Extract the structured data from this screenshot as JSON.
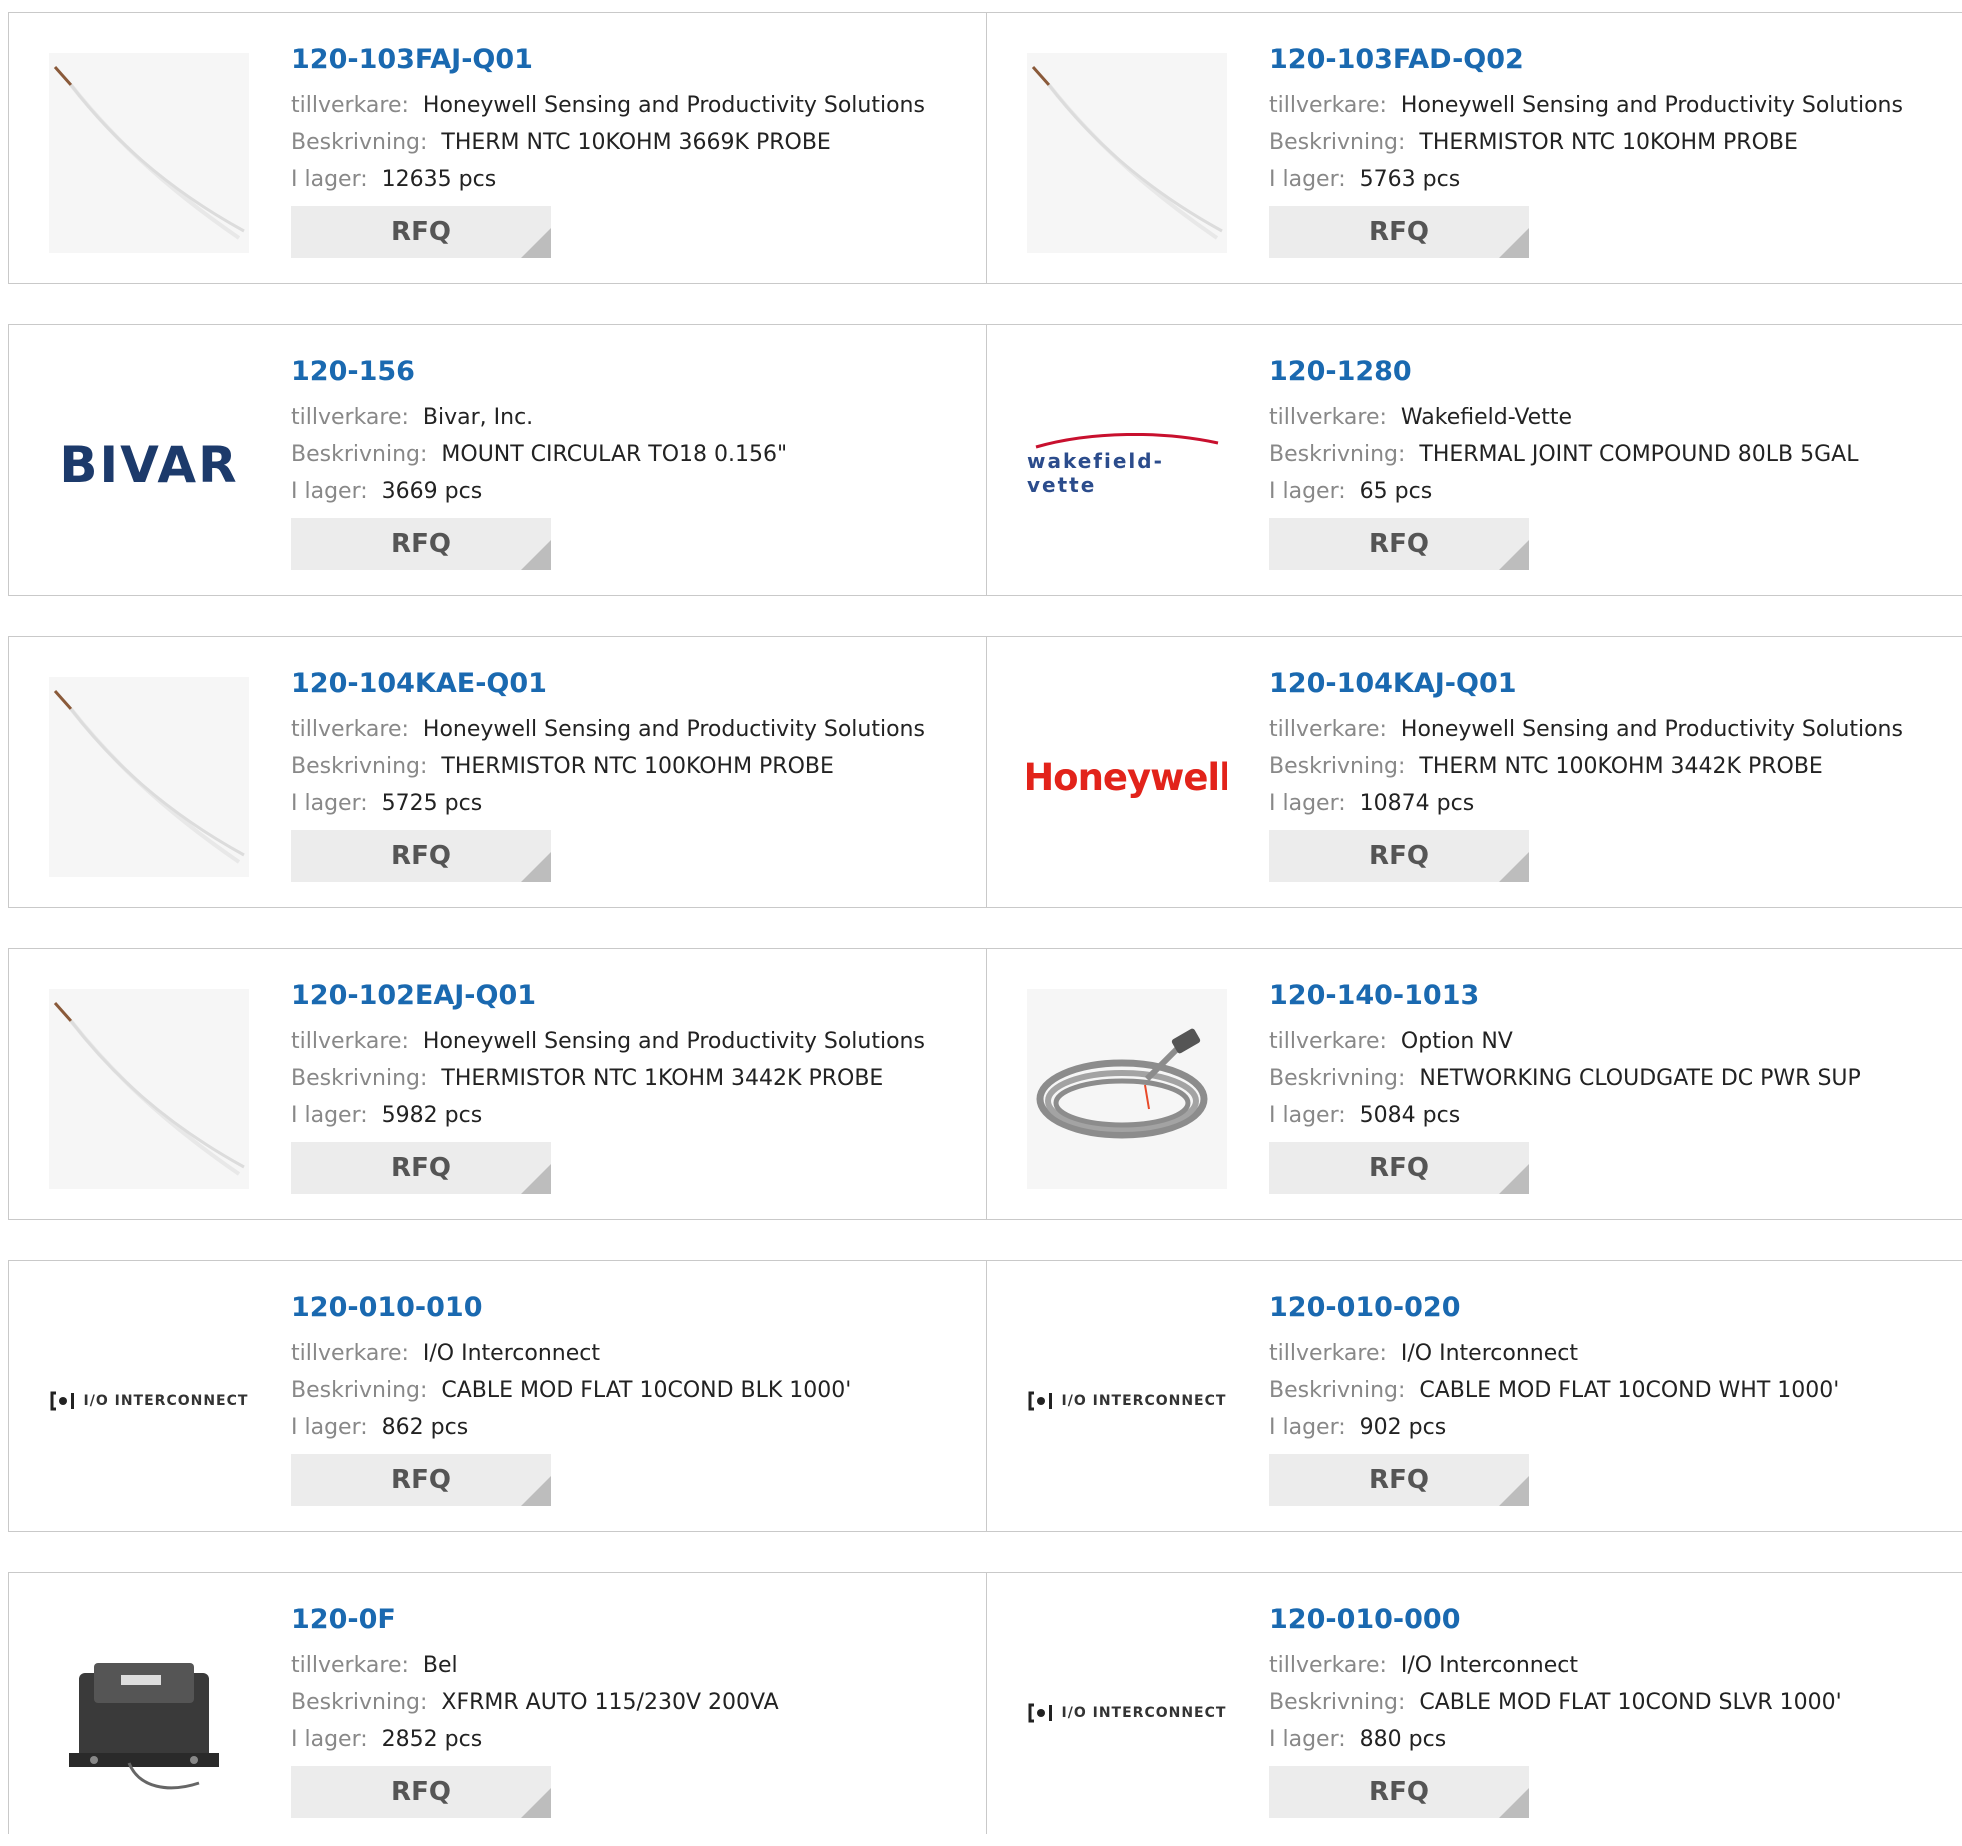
{
  "labels": {
    "manufacturer": "tillverkare:",
    "description": "Beskrivning:",
    "stock": "I lager:",
    "rfq": "RFQ"
  },
  "products": [
    {
      "pn": "120-103FAJ-Q01",
      "manufacturer": "Honeywell Sensing and Productivity Solutions",
      "description": "THERM NTC 10KOHM 3669K PROBE",
      "stock": "12635 pcs",
      "image": "thermistor-probe-image"
    },
    {
      "pn": "120-103FAD-Q02",
      "manufacturer": "Honeywell Sensing and Productivity Solutions",
      "description": "THERMISTOR NTC 10KOHM PROBE",
      "stock": "5763 pcs",
      "image": "thermistor-probe-image"
    },
    {
      "pn": "120-156",
      "manufacturer": "Bivar, Inc.",
      "description": "MOUNT CIRCULAR TO18 0.156\"",
      "stock": "3669 pcs",
      "image": "bivar-logo",
      "logo_text": "BIVAR"
    },
    {
      "pn": "120-1280",
      "manufacturer": "Wakefield-Vette",
      "description": "THERMAL JOINT COMPOUND 80LB 5GAL",
      "stock": "65 pcs",
      "image": "wakefield-vette-logo",
      "logo_text": "wakefield-vette"
    },
    {
      "pn": "120-104KAE-Q01",
      "manufacturer": "Honeywell Sensing and Productivity Solutions",
      "description": "THERMISTOR NTC 100KOHM PROBE",
      "stock": "5725 pcs",
      "image": "thermistor-probe-image"
    },
    {
      "pn": "120-104KAJ-Q01",
      "manufacturer": "Honeywell Sensing and Productivity Solutions",
      "description": "THERM NTC 100KOHM 3442K PROBE",
      "stock": "10874 pcs",
      "image": "honeywell-logo",
      "logo_text": "Honeywell"
    },
    {
      "pn": "120-102EAJ-Q01",
      "manufacturer": "Honeywell Sensing and Productivity Solutions",
      "description": "THERMISTOR NTC 1KOHM 3442K PROBE",
      "stock": "5982 pcs",
      "image": "thermistor-probe-image"
    },
    {
      "pn": "120-140-1013",
      "manufacturer": "Option NV",
      "description": "NETWORKING CLOUDGATE DC PWR SUP",
      "stock": "5084 pcs",
      "image": "power-cable-image"
    },
    {
      "pn": "120-010-010",
      "manufacturer": "I/O Interconnect",
      "description": "CABLE MOD FLAT 10COND BLK 1000'",
      "stock": "862 pcs",
      "image": "io-interconnect-logo",
      "logo_text": "I/O INTERCONNECT"
    },
    {
      "pn": "120-010-020",
      "manufacturer": "I/O Interconnect",
      "description": "CABLE MOD FLAT 10COND WHT 1000'",
      "stock": "902 pcs",
      "image": "io-interconnect-logo",
      "logo_text": "I/O INTERCONNECT"
    },
    {
      "pn": "120-0F",
      "manufacturer": "Bel",
      "description": "XFRMR AUTO 115/230V 200VA",
      "stock": "2852 pcs",
      "image": "transformer-image"
    },
    {
      "pn": "120-010-000",
      "manufacturer": "I/O Interconnect",
      "description": "CABLE MOD FLAT 10COND SLVR 1000'",
      "stock": "880 pcs",
      "image": "io-interconnect-logo",
      "logo_text": "I/O INTERCONNECT"
    }
  ],
  "colors": {
    "link": "#1a69b0",
    "label": "#888888",
    "button_bg": "#ececec",
    "border": "#c9c9c9"
  }
}
